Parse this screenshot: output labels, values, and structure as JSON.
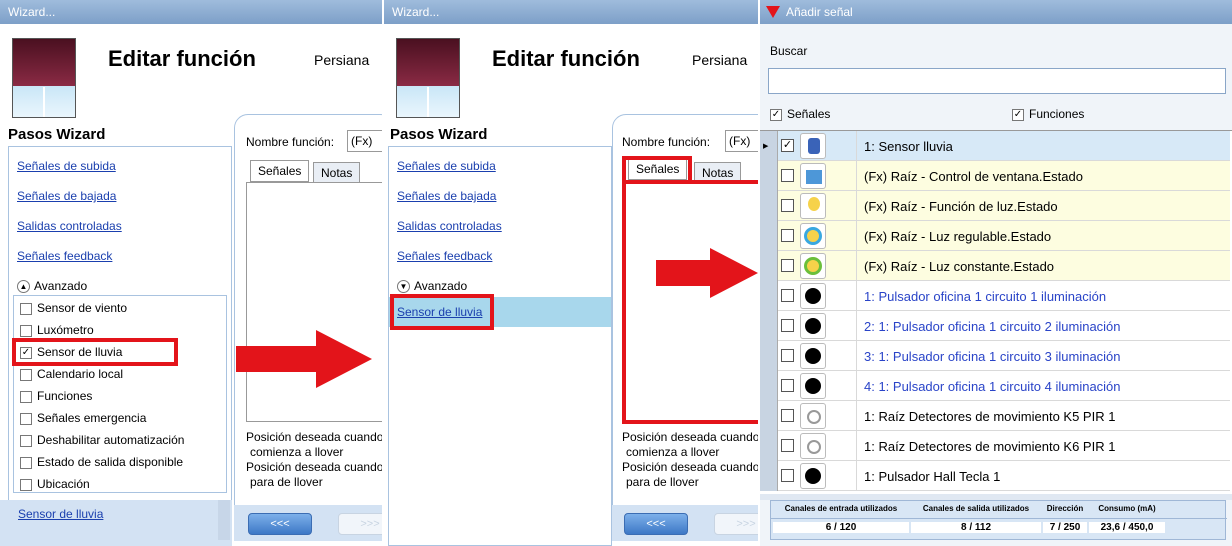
{
  "panel1": {
    "window_title": "Wizard...",
    "page_title": "Editar función",
    "object_name": "Persiana",
    "steps_title": "Pasos Wizard",
    "links": [
      "Señales de subida",
      "Señales de bajada",
      "Salidas controladas",
      "Señales feedback"
    ],
    "advanced": "Avanzado",
    "checkboxes": [
      {
        "label": "Sensor de viento",
        "checked": false
      },
      {
        "label": "Luxómetro",
        "checked": false
      },
      {
        "label": "Sensor de lluvia",
        "checked": true
      },
      {
        "label": "Calendario local",
        "checked": false
      },
      {
        "label": "Funciones",
        "checked": false
      },
      {
        "label": "Señales emergencia",
        "checked": false
      },
      {
        "label": "Deshabilitar automatización",
        "checked": false
      },
      {
        "label": "Estado de salida disponible",
        "checked": false
      },
      {
        "label": "Ubicación",
        "checked": false
      }
    ],
    "bottom_link": "Sensor de lluvia",
    "name_label": "Nombre función:",
    "name_value": "(Fx)",
    "tab_signals": "Señales",
    "tab_notes": "Notas",
    "pos1": "Posición deseada cuando",
    "pos1b": "comienza a llover",
    "pos2": "Posición deseada cuando",
    "pos2b": "para de llover",
    "back": "<<<",
    "next": ">>>"
  },
  "panel2": {
    "window_title": "Wizard...",
    "page_title": "Editar función",
    "object_name": "Persiana",
    "steps_title": "Pasos Wizard",
    "links": [
      "Señales de subida",
      "Señales de bajada",
      "Salidas controladas",
      "Señales feedback"
    ],
    "advanced": "Avanzado",
    "selected_link": "Sensor de lluvia",
    "name_label": "Nombre función:",
    "name_value": "(Fx)",
    "tab_signals": "Señales",
    "tab_notes": "Notas",
    "pos1": "Posición deseada cuando",
    "pos1b": "comienza a llover",
    "pos2": "Posición deseada cuando",
    "pos2b": "para de llover",
    "back": "<<<",
    "next": ">>>"
  },
  "panel3": {
    "window_title": "Añadir señal",
    "search_label": "Buscar",
    "search_value": "",
    "filter_signals": "Señales",
    "filter_functions": "Funciones",
    "rows": [
      {
        "label": "1: Sensor lluvia",
        "checked": true,
        "color": "#000000",
        "bg": "#d7e9f7"
      },
      {
        "label": "(Fx) Raíz - Control de ventana.Estado",
        "checked": false,
        "color": "#000000",
        "bg": "#fdfde0"
      },
      {
        "label": "(Fx) Raíz - Función de luz.Estado",
        "checked": false,
        "color": "#000000",
        "bg": "#fdfde0"
      },
      {
        "label": "(Fx) Raíz - Luz regulable.Estado",
        "checked": false,
        "color": "#000000",
        "bg": "#fdfde0"
      },
      {
        "label": "(Fx) Raíz - Luz constante.Estado",
        "checked": false,
        "color": "#000000",
        "bg": "#fdfde0"
      },
      {
        "label": "1: Pulsador oficina 1 circuito 1 iluminación",
        "checked": false,
        "color": "#2a44c8",
        "bg": "#ffffff"
      },
      {
        "label": "2: 1: Pulsador oficina 1 circuito 2 iluminación",
        "checked": false,
        "color": "#2a44c8",
        "bg": "#ffffff"
      },
      {
        "label": "3: 1: Pulsador oficina 1 circuito 3 iluminación",
        "checked": false,
        "color": "#2a44c8",
        "bg": "#ffffff"
      },
      {
        "label": "4: 1: Pulsador oficina 1 circuito 4 iluminación",
        "checked": false,
        "color": "#2a44c8",
        "bg": "#ffffff"
      },
      {
        "label": "1: Raíz Detectores de movimiento K5 PIR 1",
        "checked": false,
        "color": "#000000",
        "bg": "#ffffff"
      },
      {
        "label": "1: Raíz Detectores de movimiento K6 PIR 1",
        "checked": false,
        "color": "#000000",
        "bg": "#ffffff"
      },
      {
        "label": "1: Pulsador Hall Tecla 1",
        "checked": false,
        "color": "#000000",
        "bg": "#ffffff"
      }
    ],
    "icons": [
      "rain-sensor-icon",
      "window-icon",
      "bulb-icon",
      "dimmer-icon",
      "constant-light-icon",
      "pushbutton-icon",
      "pushbutton-icon",
      "pushbutton-icon",
      "pushbutton-icon",
      "pir-sensor-icon",
      "pir-sensor-icon",
      "pushbutton-icon"
    ],
    "stats": {
      "h1": "Canales de entrada utilizados",
      "v1": "6 / 120",
      "h2": "Canales de salida utilizados",
      "v2": "8 / 112",
      "h3": "Dirección",
      "v3": "7 / 250",
      "h4": "Consumo (mA)",
      "v4": "23,6 / 450,0"
    }
  },
  "colors": {
    "highlight": "#e3141a",
    "link": "#1a3fae",
    "titlebar": "#8aabd2"
  }
}
